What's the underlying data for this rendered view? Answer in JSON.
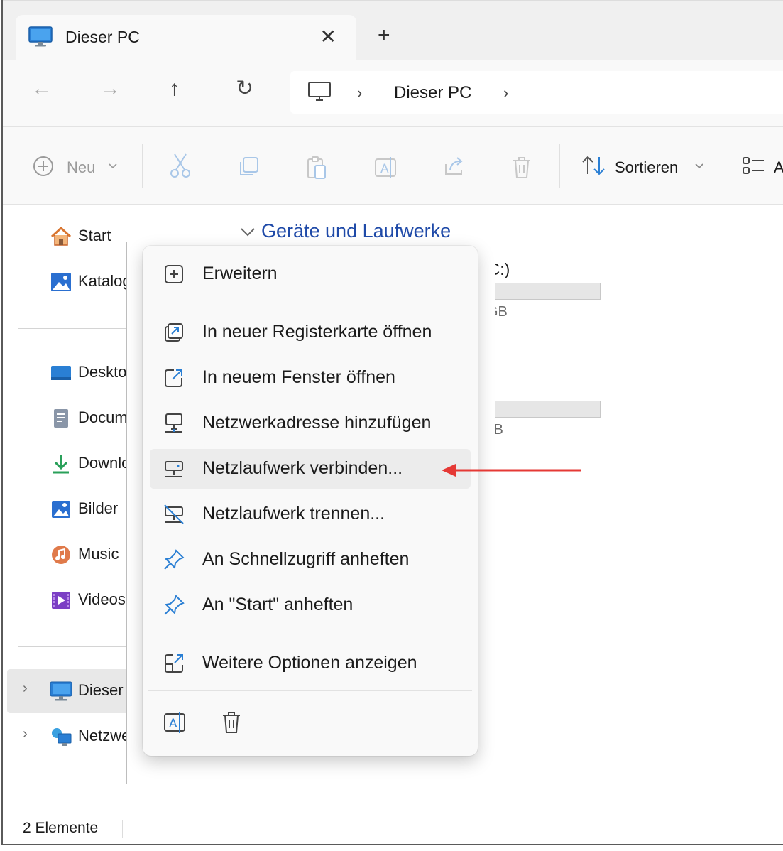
{
  "window": {
    "tab_title": "Dieser PC",
    "new_tab": "+",
    "close": "✕"
  },
  "nav": {
    "back": "←",
    "forward": "→",
    "up": "↑",
    "refresh": "↻",
    "address": "Dieser PC",
    "chevron": "›"
  },
  "toolbar": {
    "new_label": "Neu",
    "sort_label": "Sortieren",
    "view_label": "A"
  },
  "sidebar": {
    "items_top": [
      {
        "label": "Start",
        "icon": "home-icon"
      },
      {
        "label": "Katalog",
        "icon": "gallery-icon"
      }
    ],
    "items_lib": [
      {
        "label": "Desktop",
        "icon": "desktop-icon"
      },
      {
        "label": "Docume",
        "icon": "documents-icon"
      },
      {
        "label": "Downloa",
        "icon": "download-icon"
      },
      {
        "label": "Bilder",
        "icon": "pictures-icon"
      },
      {
        "label": "Music",
        "icon": "music-icon"
      },
      {
        "label": "Videos",
        "icon": "videos-icon"
      }
    ],
    "items_tree": [
      {
        "label": "Dieser P",
        "icon": "this-pc-icon"
      },
      {
        "label": "Netzwer",
        "icon": "network-icon"
      }
    ]
  },
  "content": {
    "group_title": "Geräte und Laufwerke",
    "drive1_label": "(C:)",
    "drive1_sub": "GB",
    "drive2_label": ":)",
    "drive2_sub": "GB"
  },
  "status": {
    "count": "2 Elemente"
  },
  "menu": {
    "items": [
      {
        "label": "Erweitern",
        "icon": "expand-icon"
      },
      {
        "label": "In neuer Registerkarte öffnen",
        "icon": "open-new-tab-icon"
      },
      {
        "label": "In neuem Fenster öffnen",
        "icon": "open-new-window-icon"
      },
      {
        "label": "Netzwerkadresse hinzufügen",
        "icon": "add-network-location-icon"
      },
      {
        "label": "Netzlaufwerk verbinden...",
        "icon": "map-network-drive-icon"
      },
      {
        "label": "Netzlaufwerk trennen...",
        "icon": "disconnect-network-drive-icon"
      },
      {
        "label": "An Schnellzugriff anheften",
        "icon": "pin-icon"
      },
      {
        "label": "An \"Start\" anheften",
        "icon": "pin-icon"
      },
      {
        "label": "Weitere Optionen anzeigen",
        "icon": "more-options-icon"
      }
    ],
    "highlighted_index": 4
  },
  "colors": {
    "accent": "#1f4aa8",
    "annotation_arrow": "#e53935",
    "highlight": "#ececec"
  }
}
